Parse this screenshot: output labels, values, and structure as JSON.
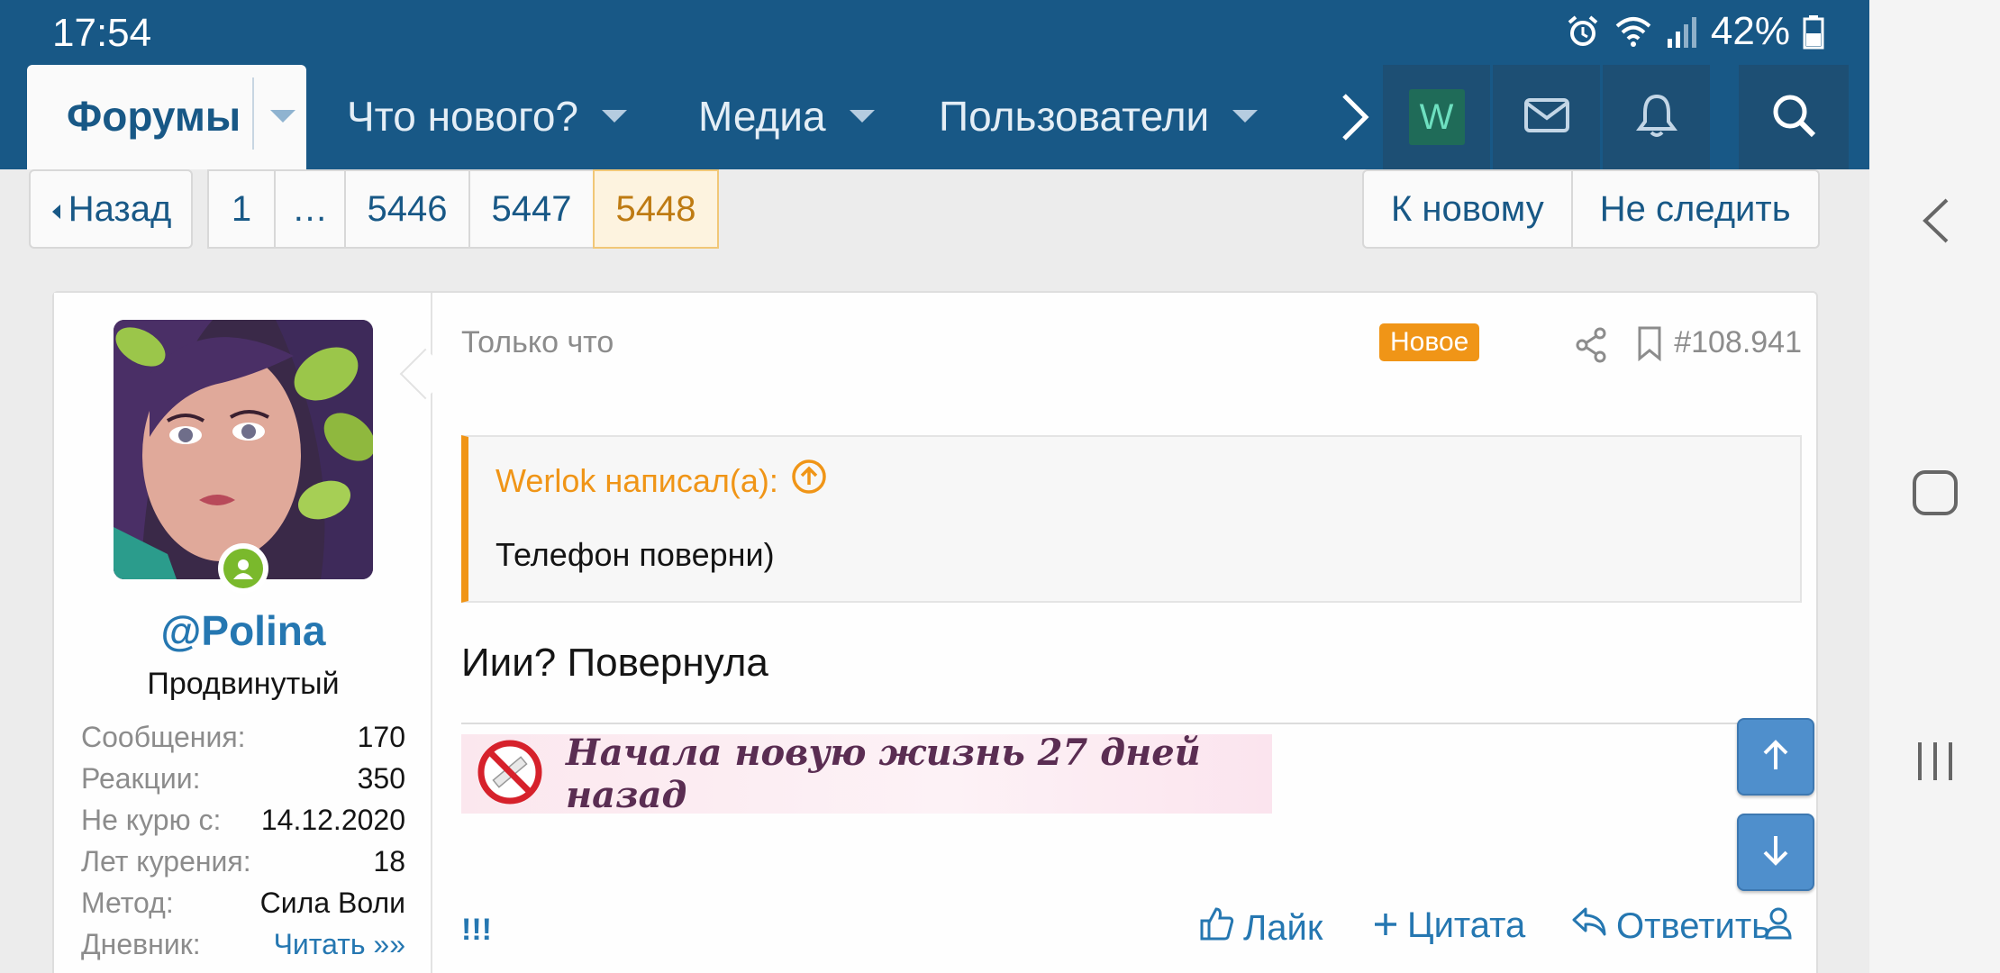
{
  "status_bar": {
    "time": "17:54",
    "battery": "42%"
  },
  "nav": {
    "forums": "Форумы",
    "whats_new": "Что нового?",
    "media": "Медиа",
    "members": "Пользователи",
    "user_initial": "W"
  },
  "pagination": {
    "back": "Назад",
    "pages": [
      "1",
      "…",
      "5446",
      "5447",
      "5448"
    ],
    "current": "5448",
    "jump_new": "К новому",
    "unwatch": "Не следить"
  },
  "post": {
    "time": "Только что",
    "badge": "Новое",
    "number": "#108.941",
    "author": {
      "name": "@Polina",
      "title": "Продвинутый",
      "stats": [
        {
          "label": "Сообщения:",
          "value": "170"
        },
        {
          "label": "Реакции:",
          "value": "350"
        },
        {
          "label": "Не курю с:",
          "value": "14.12.2020"
        },
        {
          "label": "Лет курения:",
          "value": "18"
        },
        {
          "label": "Метод:",
          "value": "Сила Воли"
        },
        {
          "label": "Дневник:",
          "value": "Читать »»"
        }
      ]
    },
    "quote": {
      "author_line": "Werlok написал(a):",
      "text": "Телефон поверни)"
    },
    "text": "Иии? Повернула",
    "signature": "Начала новую жизнь 27 дней назад",
    "actions": {
      "report": "!!!",
      "like": "Лайк",
      "quote": "Цитата",
      "reply": "Ответить"
    }
  },
  "colors": {
    "header": "#185886",
    "accent": "#f09517",
    "link": "#2577b1"
  }
}
